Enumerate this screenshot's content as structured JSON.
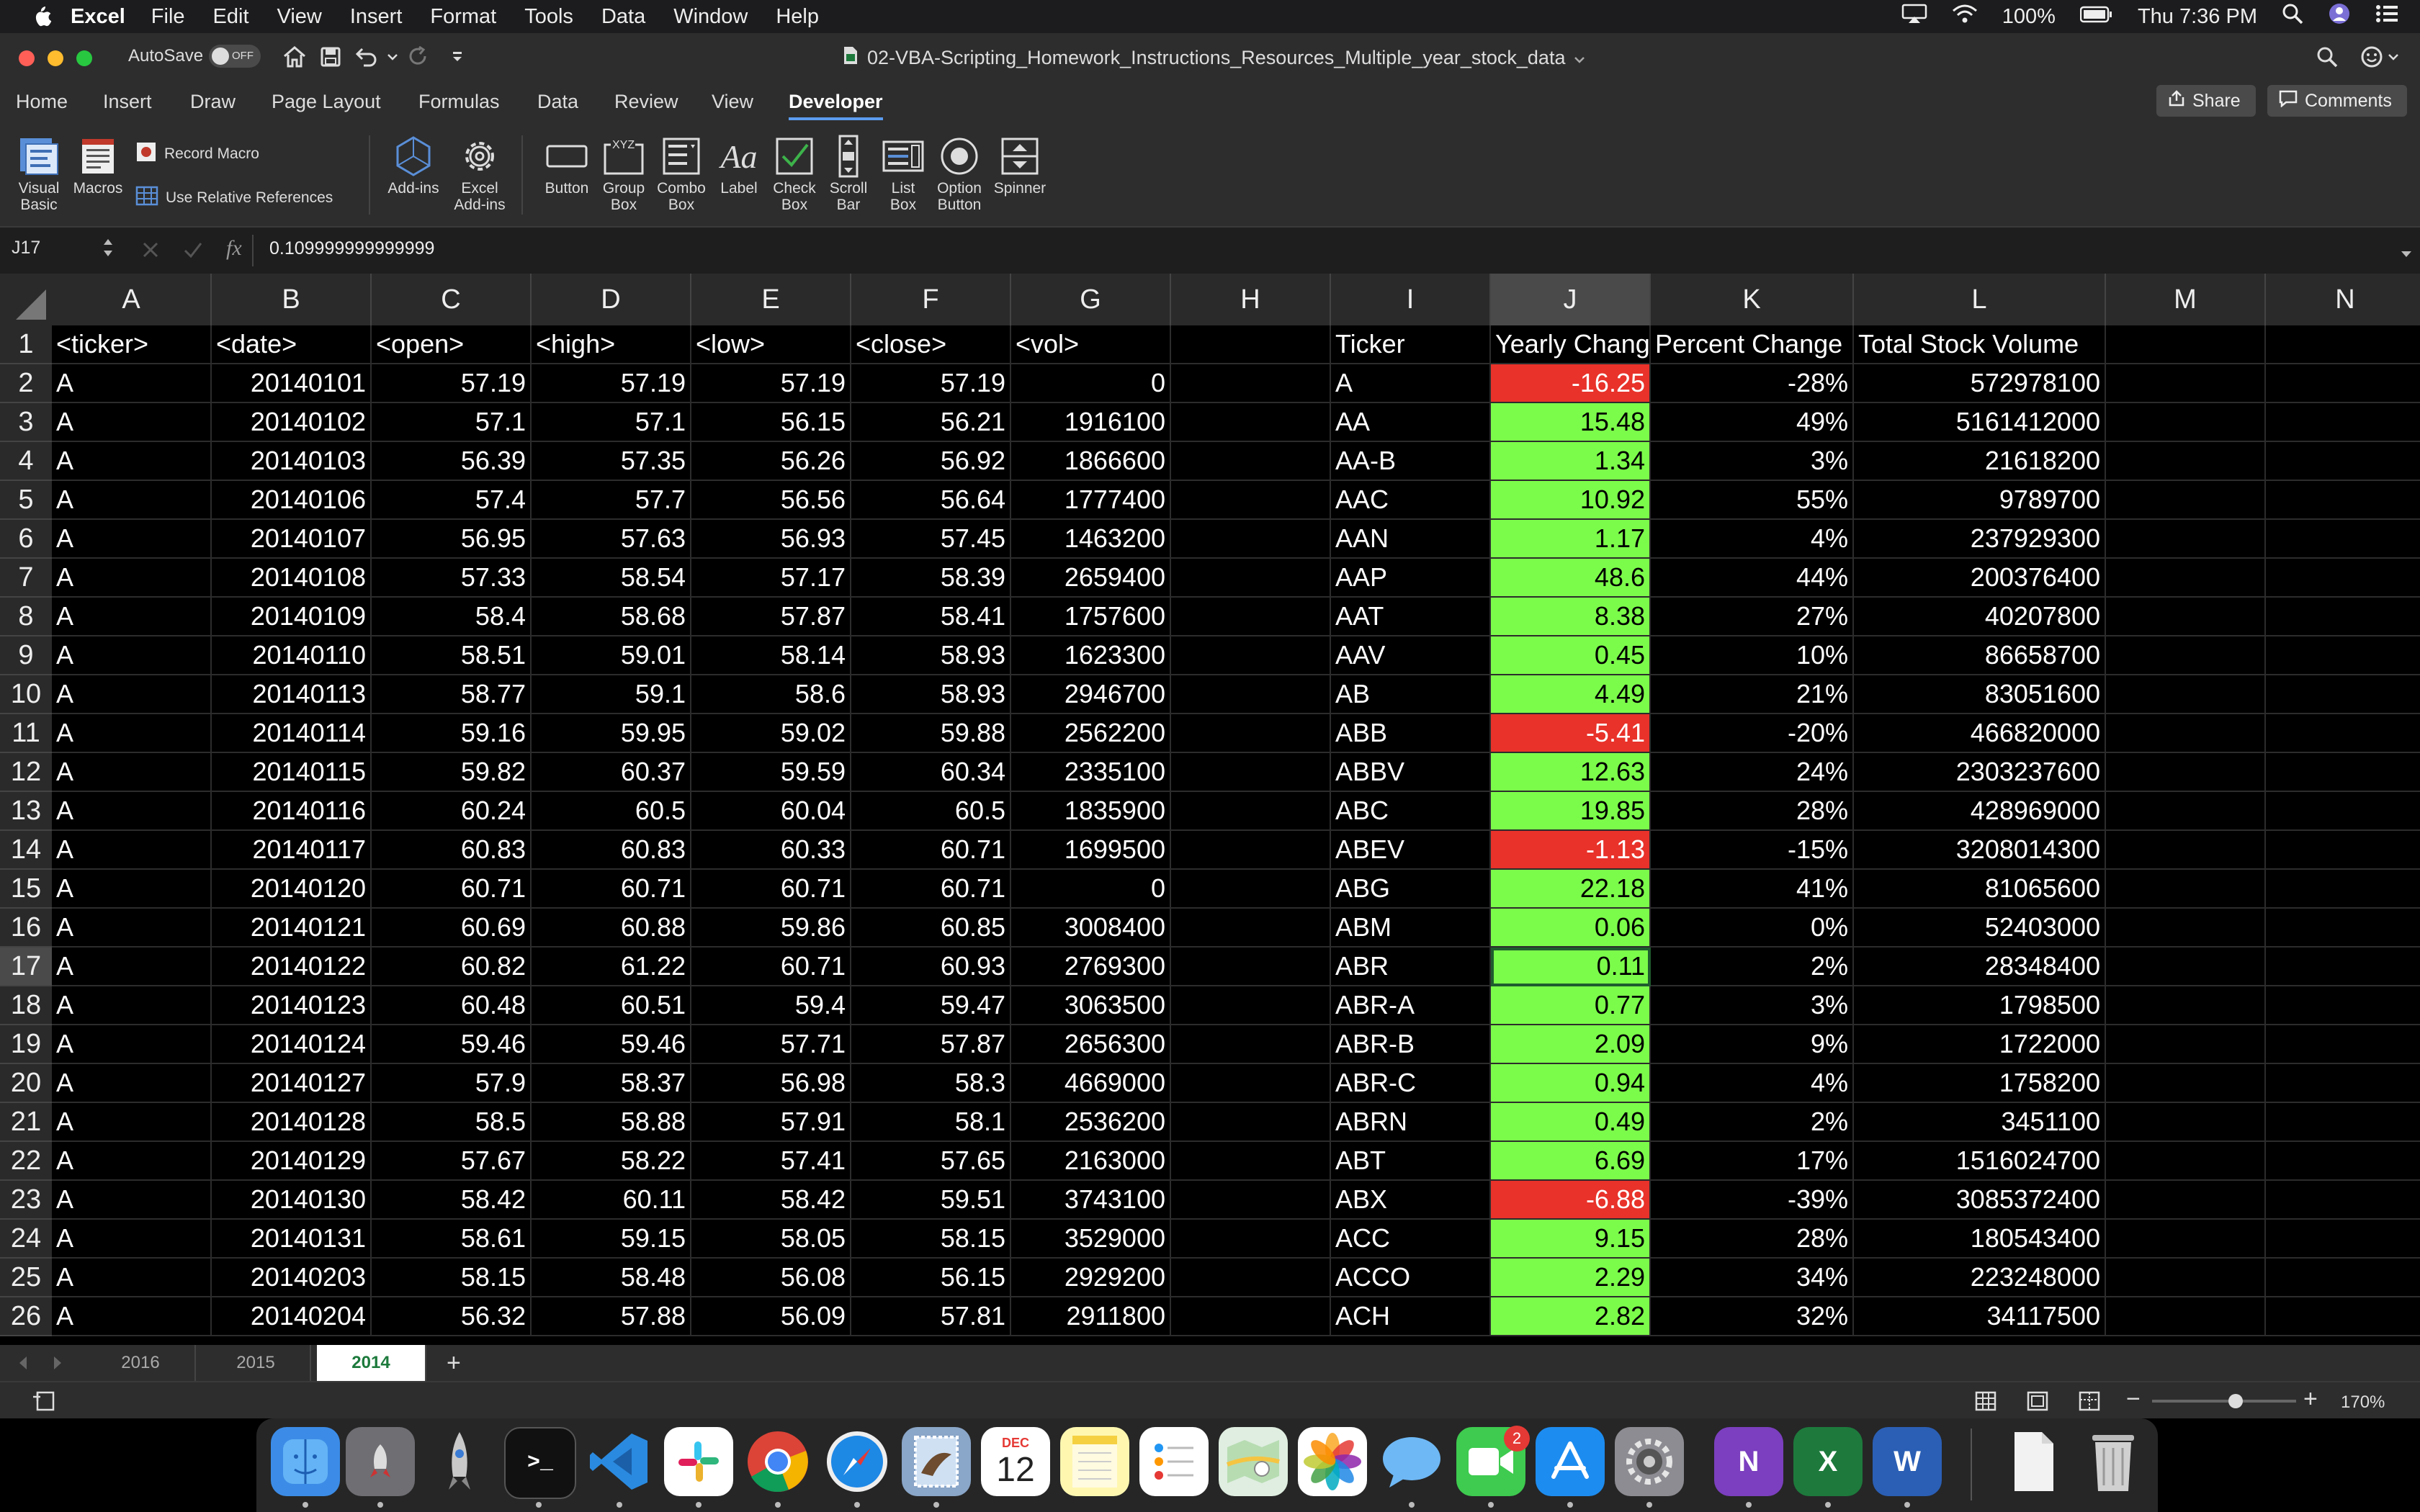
{
  "menubar": {
    "app": "Excel",
    "items": [
      "File",
      "Edit",
      "View",
      "Insert",
      "Format",
      "Tools",
      "Data",
      "Window",
      "Help"
    ],
    "battery": "100%",
    "clock": "Thu 7:36 PM"
  },
  "titlebar": {
    "autosave_label": "AutoSave",
    "autosave_state": "OFF",
    "doc_title": "02-VBA-Scripting_Homework_Instructions_Resources_Multiple_year_stock_data"
  },
  "ribbon_tabs": {
    "tabs": [
      "Home",
      "Insert",
      "Draw",
      "Page Layout",
      "Formulas",
      "Data",
      "Review",
      "View",
      "Developer"
    ],
    "active": "Developer",
    "share": "Share",
    "comments": "Comments"
  },
  "ribbon": {
    "visual_basic": [
      "Visual",
      "Basic"
    ],
    "macros": "Macros",
    "record_macro": "Record Macro",
    "relative_refs": "Use Relative References",
    "addins": "Add-ins",
    "excel_addins": [
      "Excel",
      "Add-ins"
    ],
    "button": "Button",
    "group_box": [
      "Group",
      "Box"
    ],
    "combo_box": [
      "Combo",
      "Box"
    ],
    "label": "Label",
    "check_box": [
      "Check",
      "Box"
    ],
    "scroll_bar": [
      "Scroll",
      "Bar"
    ],
    "list_box": [
      "List",
      "Box"
    ],
    "option_button": [
      "Option",
      "Button"
    ],
    "spinner": "Spinner"
  },
  "formula_bar": {
    "name_box": "J17",
    "fx": "fx",
    "formula": "0.109999999999999"
  },
  "grid": {
    "columns": [
      "A",
      "B",
      "C",
      "D",
      "E",
      "F",
      "G",
      "H",
      "I",
      "J",
      "K",
      "L",
      "M",
      "N"
    ],
    "selected_col": "J",
    "selected_row": 17,
    "rows": [
      [
        "<ticker>",
        "<date>",
        "<open>",
        "<high>",
        "<low>",
        "<close>",
        "<vol>",
        "",
        "Ticker",
        "Yearly Change",
        "Percent Change",
        "Total Stock Volume",
        "",
        ""
      ],
      [
        "A",
        "20140101",
        "57.19",
        "57.19",
        "57.19",
        "57.19",
        "0",
        "",
        "A",
        "-16.25",
        "-28%",
        "572978100",
        "",
        ""
      ],
      [
        "A",
        "20140102",
        "57.1",
        "57.1",
        "56.15",
        "56.21",
        "1916100",
        "",
        "AA",
        "15.48",
        "49%",
        "5161412000",
        "",
        ""
      ],
      [
        "A",
        "20140103",
        "56.39",
        "57.35",
        "56.26",
        "56.92",
        "1866600",
        "",
        "AA-B",
        "1.34",
        "3%",
        "21618200",
        "",
        ""
      ],
      [
        "A",
        "20140106",
        "57.4",
        "57.7",
        "56.56",
        "56.64",
        "1777400",
        "",
        "AAC",
        "10.92",
        "55%",
        "9789700",
        "",
        ""
      ],
      [
        "A",
        "20140107",
        "56.95",
        "57.63",
        "56.93",
        "57.45",
        "1463200",
        "",
        "AAN",
        "1.17",
        "4%",
        "237929300",
        "",
        ""
      ],
      [
        "A",
        "20140108",
        "57.33",
        "58.54",
        "57.17",
        "58.39",
        "2659400",
        "",
        "AAP",
        "48.6",
        "44%",
        "200376400",
        "",
        ""
      ],
      [
        "A",
        "20140109",
        "58.4",
        "58.68",
        "57.87",
        "58.41",
        "1757600",
        "",
        "AAT",
        "8.38",
        "27%",
        "40207800",
        "",
        ""
      ],
      [
        "A",
        "20140110",
        "58.51",
        "59.01",
        "58.14",
        "58.93",
        "1623300",
        "",
        "AAV",
        "0.45",
        "10%",
        "86658700",
        "",
        ""
      ],
      [
        "A",
        "20140113",
        "58.77",
        "59.1",
        "58.6",
        "58.93",
        "2946700",
        "",
        "AB",
        "4.49",
        "21%",
        "83051600",
        "",
        ""
      ],
      [
        "A",
        "20140114",
        "59.16",
        "59.95",
        "59.02",
        "59.88",
        "2562200",
        "",
        "ABB",
        "-5.41",
        "-20%",
        "466820000",
        "",
        ""
      ],
      [
        "A",
        "20140115",
        "59.82",
        "60.37",
        "59.59",
        "60.34",
        "2335100",
        "",
        "ABBV",
        "12.63",
        "24%",
        "2303237600",
        "",
        ""
      ],
      [
        "A",
        "20140116",
        "60.24",
        "60.5",
        "60.04",
        "60.5",
        "1835900",
        "",
        "ABC",
        "19.85",
        "28%",
        "428969000",
        "",
        ""
      ],
      [
        "A",
        "20140117",
        "60.83",
        "60.83",
        "60.33",
        "60.71",
        "1699500",
        "",
        "ABEV",
        "-1.13",
        "-15%",
        "3208014300",
        "",
        ""
      ],
      [
        "A",
        "20140120",
        "60.71",
        "60.71",
        "60.71",
        "60.71",
        "0",
        "",
        "ABG",
        "22.18",
        "41%",
        "81065600",
        "",
        ""
      ],
      [
        "A",
        "20140121",
        "60.69",
        "60.88",
        "59.86",
        "60.85",
        "3008400",
        "",
        "ABM",
        "0.06",
        "0%",
        "52403000",
        "",
        ""
      ],
      [
        "A",
        "20140122",
        "60.82",
        "61.22",
        "60.71",
        "60.93",
        "2769300",
        "",
        "ABR",
        "0.11",
        "2%",
        "28348400",
        "",
        ""
      ],
      [
        "A",
        "20140123",
        "60.48",
        "60.51",
        "59.4",
        "59.47",
        "3063500",
        "",
        "ABR-A",
        "0.77",
        "3%",
        "1798500",
        "",
        ""
      ],
      [
        "A",
        "20140124",
        "59.46",
        "59.46",
        "57.71",
        "57.87",
        "2656300",
        "",
        "ABR-B",
        "2.09",
        "9%",
        "1722000",
        "",
        ""
      ],
      [
        "A",
        "20140127",
        "57.9",
        "58.37",
        "56.98",
        "58.3",
        "4669000",
        "",
        "ABR-C",
        "0.94",
        "4%",
        "1758200",
        "",
        ""
      ],
      [
        "A",
        "20140128",
        "58.5",
        "58.88",
        "57.91",
        "58.1",
        "2536200",
        "",
        "ABRN",
        "0.49",
        "2%",
        "3451100",
        "",
        ""
      ],
      [
        "A",
        "20140129",
        "57.67",
        "58.22",
        "57.41",
        "57.65",
        "2163000",
        "",
        "ABT",
        "6.69",
        "17%",
        "1516024700",
        "",
        ""
      ],
      [
        "A",
        "20140130",
        "58.42",
        "60.11",
        "58.42",
        "59.51",
        "3743100",
        "",
        "ABX",
        "-6.88",
        "-39%",
        "3085372400",
        "",
        ""
      ],
      [
        "A",
        "20140131",
        "58.61",
        "59.15",
        "58.05",
        "58.15",
        "3529000",
        "",
        "ACC",
        "9.15",
        "28%",
        "180543400",
        "",
        ""
      ],
      [
        "A",
        "20140203",
        "58.15",
        "58.48",
        "56.08",
        "56.15",
        "2929200",
        "",
        "ACCO",
        "2.29",
        "34%",
        "223248000",
        "",
        ""
      ],
      [
        "A",
        "20140204",
        "56.32",
        "57.88",
        "56.09",
        "57.81",
        "2911800",
        "",
        "ACH",
        "2.82",
        "32%",
        "34117500",
        "",
        ""
      ]
    ],
    "colors": {
      "negative": "#e8322a",
      "positive": "#7cfc4a"
    }
  },
  "sheets": {
    "tabs": [
      "2016",
      "2015",
      "2014"
    ],
    "active": "2014",
    "add": "+"
  },
  "statusbar": {
    "zoom": "170%"
  },
  "dock": {
    "calendar_month": "DEC",
    "calendar_day": "12",
    "facetime_badge": "2",
    "onenote": "N",
    "excel": "X",
    "word": "W"
  }
}
